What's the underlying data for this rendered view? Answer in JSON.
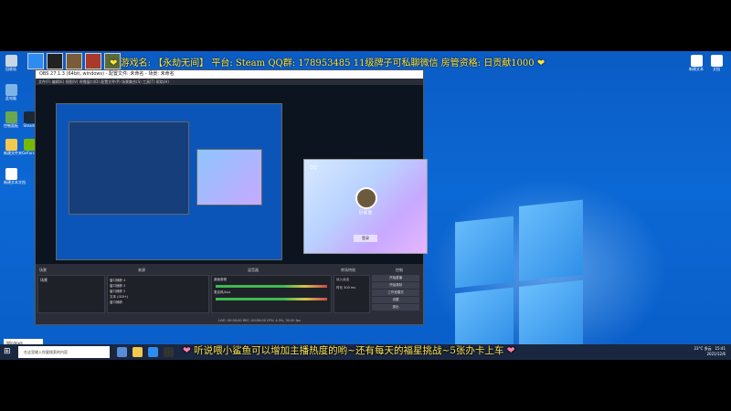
{
  "banner": {
    "game_label": "游戏名:",
    "game_name": "【永劫无间】",
    "platform_label": "平台:",
    "platform": "Steam",
    "qq_group": "QQ群: 178953485",
    "rule": "11级牌子可私聊微信",
    "manager": "房管资格: 日贡献1000"
  },
  "obs": {
    "title": "OBS 27.1.3 (64bit, windows) - 配置文件: 未命名 - 场景: 未命名",
    "menu": "文件(F)  编辑(E)  视图(V)  停靠窗口(D)  配置文件(P)  场景集合(S)  工具(T)  帮助(H)",
    "docks": {
      "scenes": "场景",
      "sources": "来源",
      "mixer": "混音器",
      "transitions": "转场特效",
      "controls": "控制"
    },
    "sources": [
      "窗口捕获 4",
      "窗口捕获 3",
      "窗口捕获 2",
      "文本 (GDI+)",
      "窗口捕获"
    ],
    "scene_item": "场景",
    "mixer_tracks": [
      "桌面音频",
      "麦克风/Aux"
    ],
    "controls": [
      "开始直播",
      "开始录制",
      "工作室模式",
      "设置",
      "退出"
    ],
    "transition": "淡入淡出",
    "duration_label": "时长",
    "duration": "300 ms",
    "status": "LIVE: 00:00:00   REC: 00:00:00   CPU: 4.3%, 30.00 fps"
  },
  "qq": {
    "logo": "QQ",
    "name": "巨鲨鱼",
    "login": "登录"
  },
  "taskbar": {
    "search_placeholder": "在这里输入你要搜索的内容",
    "weather": "23°C 多云",
    "time": "15:41",
    "date": "2021/12/6"
  },
  "notice": "Windows",
  "subtitle": {
    "text": "听说喂小鲨鱼可以增加主播热度的哟~还有每天的福星挑战~5张办卡上车"
  },
  "desktop_icons": [
    {
      "label": "回收站",
      "icon": "recycle-bin-icon",
      "color": "#c9d6e6"
    },
    {
      "label": "Steam",
      "icon": "steam-icon",
      "color": "#1b2838"
    },
    {
      "label": "此电脑",
      "icon": "computer-icon",
      "color": "#7fb4e8"
    },
    {
      "label": "控制面板",
      "icon": "control-panel-icon",
      "color": "#6aa84f"
    },
    {
      "label": "EPIC",
      "icon": "epic-icon",
      "color": "#222"
    },
    {
      "label": "新建文件夹",
      "icon": "folder-icon",
      "color": "#f2c94c"
    },
    {
      "label": "GeForce",
      "icon": "nvidia-icon",
      "color": "#76b900"
    },
    {
      "label": "QQ",
      "icon": "qq-icon",
      "color": "#2d8cf0"
    },
    {
      "label": "新建文本文档",
      "icon": "text-file-icon",
      "color": "#ffffff"
    }
  ],
  "right_icons": [
    {
      "label": "新建文本",
      "icon": "text-file-icon"
    },
    {
      "label": "文档",
      "icon": "text-file-icon"
    }
  ]
}
